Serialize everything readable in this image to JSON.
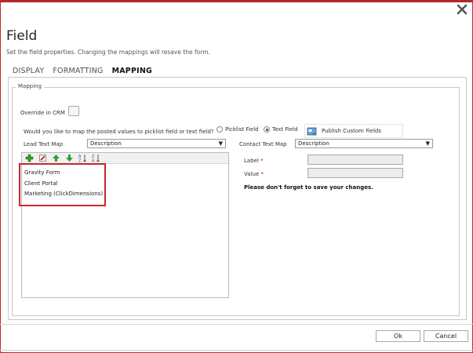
{
  "dialog": {
    "title": "Field",
    "subtitle": "Set the field properties. Changing the mappings will resave the form."
  },
  "tabs": [
    {
      "label": "DISPLAY",
      "active": false
    },
    {
      "label": "FORMATTING",
      "active": false
    },
    {
      "label": "MAPPING",
      "active": true
    }
  ],
  "mapping": {
    "legend": "Mapping",
    "override_label": "Override in CRM",
    "override_checked": false,
    "question": "Would you like to map the posted values to picklist field or text field?",
    "options": [
      {
        "label": "Picklist Field",
        "selected": false
      },
      {
        "label": "Text Field",
        "selected": true
      }
    ],
    "publish_label": "Publish Custom Fields",
    "lead_label": "Lead Text Map",
    "lead_value": "Description",
    "contact_label": "Contact Text Map",
    "contact_value": "Description",
    "list_items": [
      "Gravity Form",
      "Client Portal",
      "Marketing (ClickDimensions)"
    ],
    "label_field": "Label",
    "value_field": "Value",
    "required_mark": "*",
    "reminder": "Please don't forget to save your changes."
  },
  "footer": {
    "ok": "Ok",
    "cancel": "Cancel"
  },
  "colors": {
    "accent_red": "#c8262c",
    "add_green": "#2f9e2f"
  }
}
